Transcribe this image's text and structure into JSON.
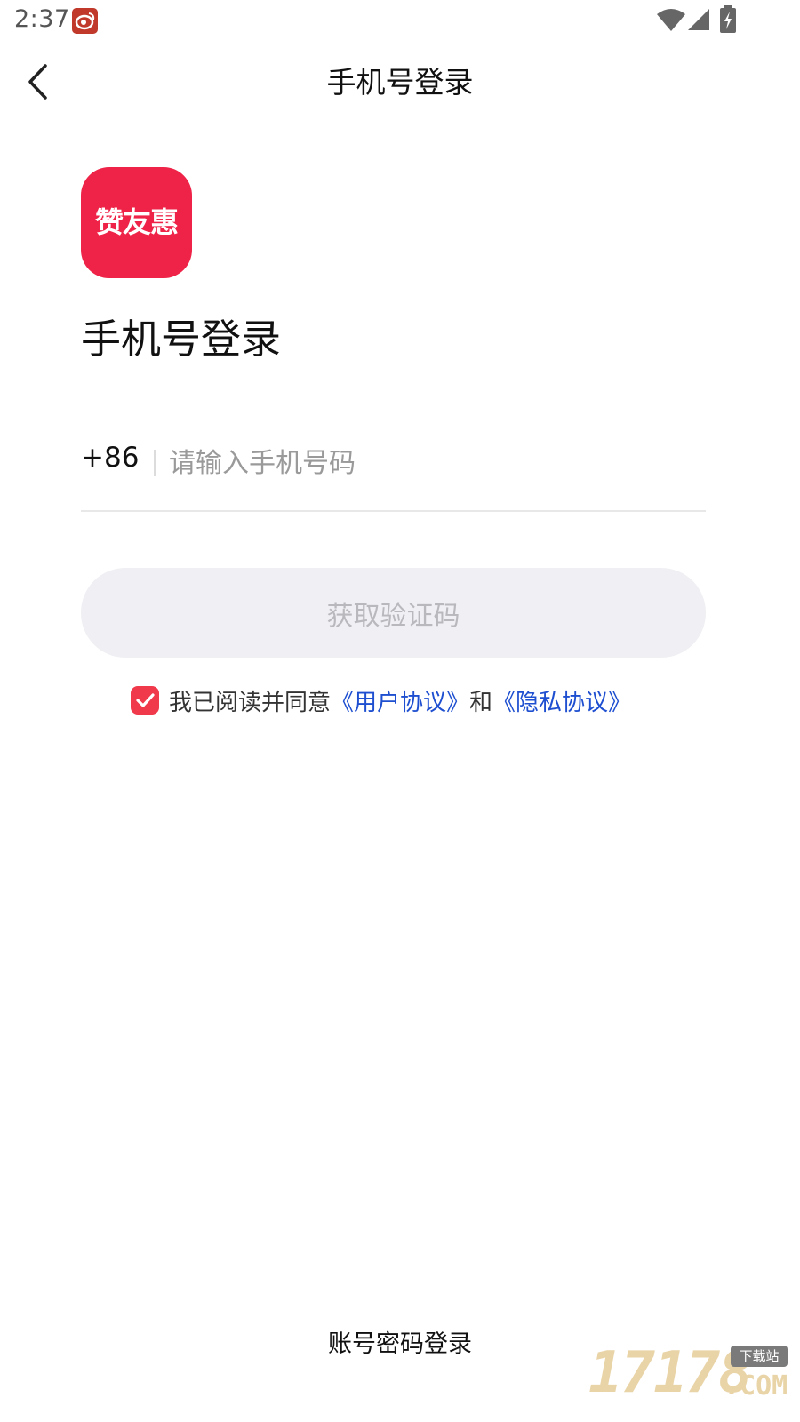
{
  "status_bar": {
    "time": "2:37",
    "notification_icon": "weibo-icon",
    "wifi_icon": "wifi-icon",
    "signal_icon": "signal-icon",
    "battery_icon": "battery-charging-icon"
  },
  "header": {
    "back_icon": "chevron-left-icon",
    "title": "手机号登录"
  },
  "app": {
    "logo_text": "赞友惠",
    "brand_color": "#ee2347"
  },
  "login": {
    "heading": "手机号登录",
    "country_code": "+86",
    "phone_value": "",
    "phone_placeholder": "请输入手机号码",
    "get_code_label": "获取验证码"
  },
  "agreement": {
    "checked": true,
    "prefix": "我已阅读并同意",
    "user_agreement": "《用户协议》",
    "conjunction": "和",
    "privacy_agreement": "《隐私协议》",
    "link_color": "#1e4fd0",
    "checkbox_color": "#f0394a"
  },
  "footer": {
    "password_login": "账号密码登录"
  },
  "watermark": {
    "number": "17178",
    "badge": "下载站",
    "suffix": ".COM"
  }
}
